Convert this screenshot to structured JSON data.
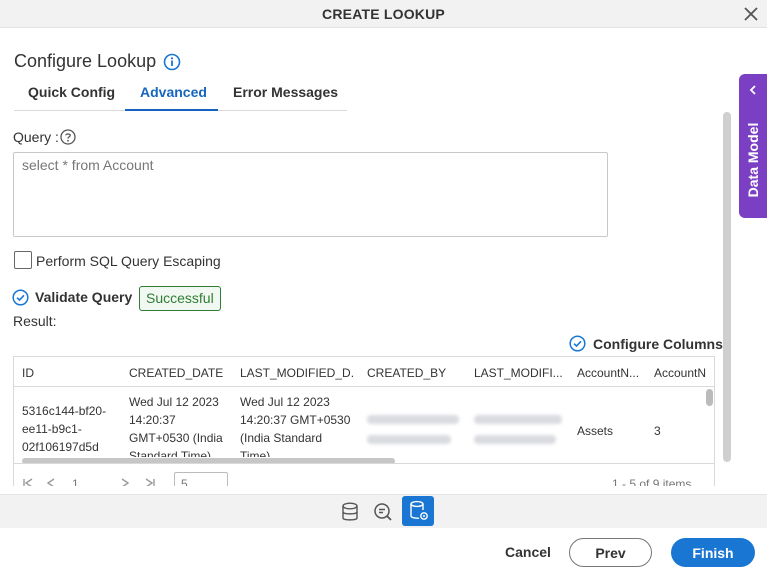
{
  "window": {
    "title": "CREATE LOOKUP"
  },
  "page": {
    "heading": "Configure Lookup"
  },
  "tabs": [
    {
      "label": "Quick Config",
      "active": false
    },
    {
      "label": "Advanced",
      "active": true
    },
    {
      "label": "Error Messages",
      "active": false
    }
  ],
  "query": {
    "label": "Query :",
    "value": "select * from Account"
  },
  "escaping": {
    "label": "Perform SQL Query Escaping",
    "checked": false
  },
  "validate": {
    "label": "Validate Query",
    "status": "Successful"
  },
  "result": {
    "label": "Result:"
  },
  "configure_columns": {
    "label": "Configure Columns"
  },
  "grid": {
    "columns": [
      "ID",
      "CREATED_DATE",
      "LAST_MODIFIED_D...",
      "CREATED_BY",
      "LAST_MODIFI...",
      "AccountN...",
      "AccountN"
    ],
    "rows": [
      {
        "id_lines": [
          "5316c144-bf20-",
          "ee11-b9c1-",
          "02f106197d5d"
        ],
        "created_lines": [
          "Wed Jul 12 2023",
          "14:20:37",
          "GMT+0530 (India",
          "Standard Time)"
        ],
        "modified_lines": [
          "Wed Jul 12 2023",
          "14:20:37 GMT+0530",
          "(India Standard",
          "Time)"
        ],
        "account_name": "Assets",
        "account_number": "3"
      }
    ]
  },
  "pager": {
    "page": "1",
    "page_size": "5",
    "summary": "1 - 5 of 9 items"
  },
  "sidebar": {
    "label": "Data Model"
  },
  "footer": {
    "cancel": "Cancel",
    "prev": "Prev",
    "finish": "Finish"
  },
  "colors": {
    "accent": "#1976d2",
    "success": "#2e7d32",
    "sidebar": "#7b3fc4"
  }
}
